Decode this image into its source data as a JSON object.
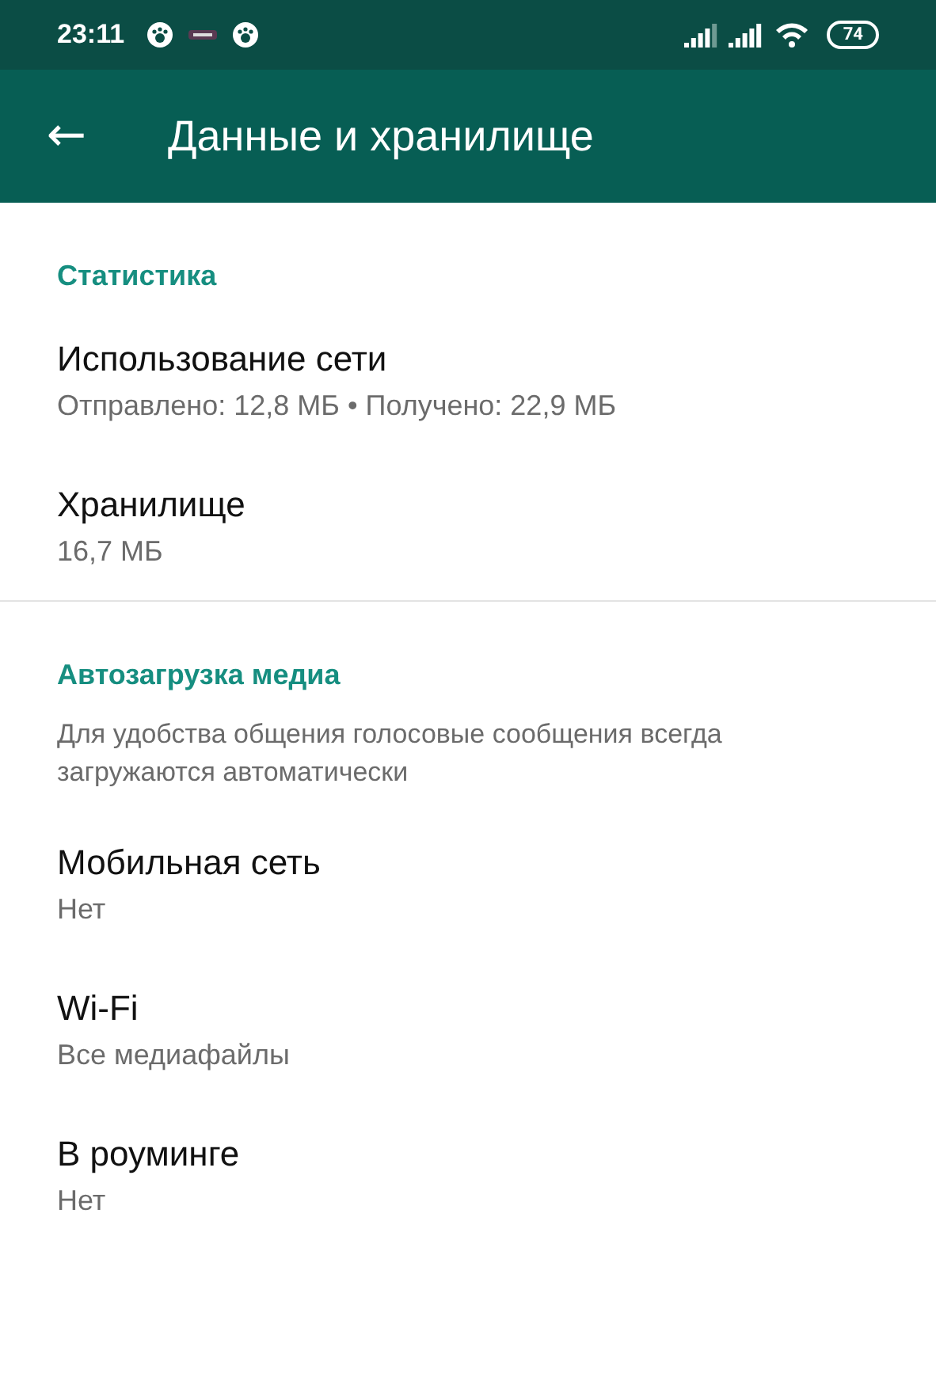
{
  "status_bar": {
    "time": "23:11",
    "battery": "74"
  },
  "app_bar": {
    "back": "←",
    "title": "Данные и хранилище"
  },
  "sections": [
    {
      "header": "Статистика",
      "items": [
        {
          "title": "Использование сети",
          "subtitle": "Отправлено: 12,8 МБ • Получено: 22,9 МБ"
        },
        {
          "title": "Хранилище",
          "subtitle": "16,7 МБ"
        }
      ]
    },
    {
      "header": "Автозагрузка медиа",
      "note": "Для удобства общения голосовые сообщения всегда загружаются автоматически",
      "items": [
        {
          "title": "Мобильная сеть",
          "subtitle": "Нет"
        },
        {
          "title": "Wi-Fi",
          "subtitle": "Все медиафайлы"
        },
        {
          "title": "В роуминге",
          "subtitle": "Нет"
        }
      ]
    }
  ]
}
